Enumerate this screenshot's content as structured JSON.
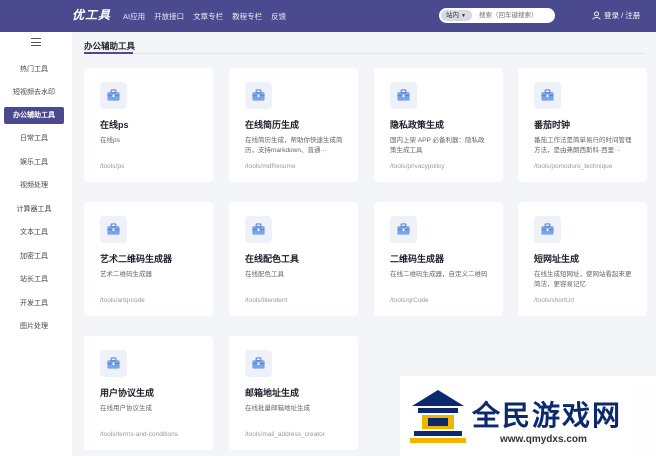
{
  "header": {
    "logo": "优工具",
    "nav": [
      "AI应用",
      "开放接口",
      "文章专栏",
      "教程专栏",
      "反馈"
    ],
    "search_scope": "站内",
    "search_placeholder": "搜索（回车键搜索）",
    "user_label": "登录 / 注册"
  },
  "sidebar": {
    "items": [
      "热门工具",
      "短视频去水印",
      "办公辅助工具",
      "日常工具",
      "娱乐工具",
      "视频处理",
      "计算器工具",
      "文本工具",
      "加密工具",
      "站长工具",
      "开发工具",
      "图片处理"
    ],
    "active_index": 2
  },
  "main": {
    "section_title": "办公辅助工具",
    "cards": [
      {
        "title": "在线ps",
        "desc": "在线ps",
        "path": "/tools/ps"
      },
      {
        "title": "在线简历生成",
        "desc": "在线简历生成，帮助你快速生成简历，支持markdown、普通···",
        "path": "/tools/mdResume"
      },
      {
        "title": "隐私政策生成",
        "desc": "国内上架 APP 必备利器：隐私政策生成工具",
        "path": "/tools/privacypolicy"
      },
      {
        "title": "番茄时钟",
        "desc": "番茄工作法是简单易行的时间管理方法，是由弗朗西斯科·西里···",
        "path": "/tools/pomodoro_technique"
      },
      {
        "title": "艺术二维码生成器",
        "desc": "艺术二维码生成器",
        "path": "/tools/artqrcode"
      },
      {
        "title": "在线配色工具",
        "desc": "在线配色工具",
        "path": "/tools/blendent"
      },
      {
        "title": "二维码生成器",
        "desc": "在线二维码生成器，自定义二维码",
        "path": "/tools/qrCode"
      },
      {
        "title": "短网址生成",
        "desc": "在线生成短网址，使网站看起来更简洁，更容易记忆",
        "path": "/tools/shortUrl"
      },
      {
        "title": "用户协议生成",
        "desc": "在线用户协议生成",
        "path": "/tools/terms-and-conditions"
      },
      {
        "title": "邮箱地址生成",
        "desc": "在线批量邮箱地址生成",
        "path": "/tools/mail_address_creator"
      }
    ]
  },
  "watermark": {
    "name": "全民游戏网",
    "url": "www.qmydxs.com"
  },
  "colors": {
    "brand": "#4b4a8f",
    "background": "#f4f5f9",
    "icon_tile": "#eef1f8"
  }
}
